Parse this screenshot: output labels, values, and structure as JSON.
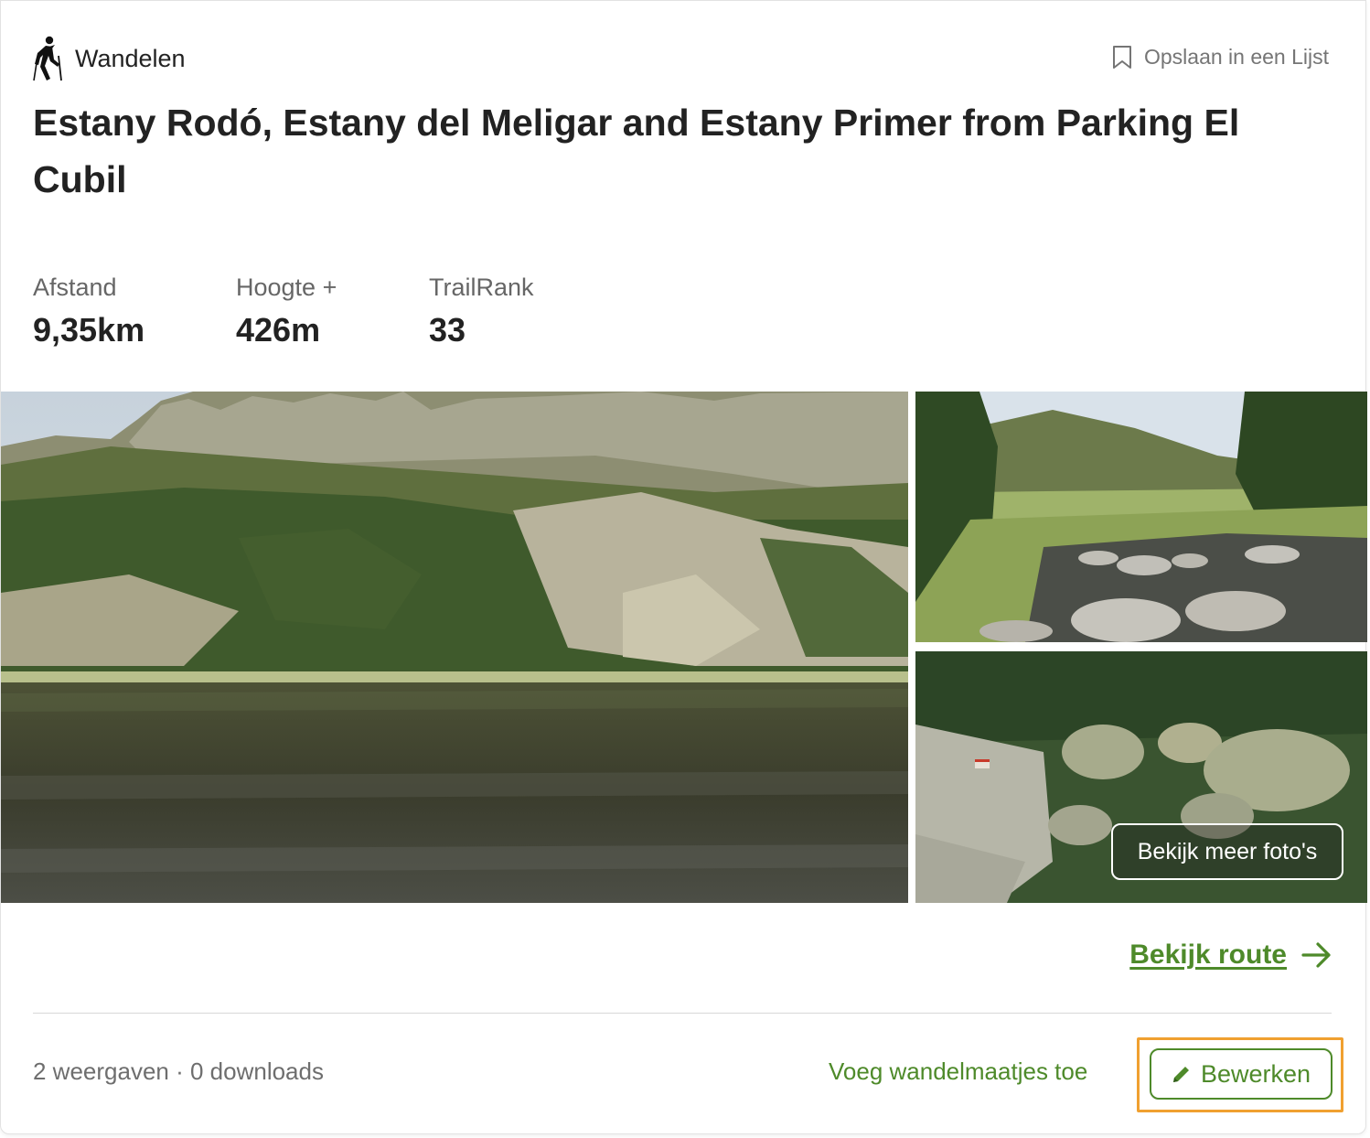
{
  "activity": {
    "icon": "hiker-icon",
    "label": "Wandelen"
  },
  "save_list": {
    "icon": "bookmark-icon",
    "label": "Opslaan in een Lijst"
  },
  "title": "Estany Rodó, Estany del Meligar and Estany Primer from Parking El Cubil",
  "stats": [
    {
      "label": "Afstand",
      "value": "9,35km"
    },
    {
      "label": "Hoogte +",
      "value": "426m"
    },
    {
      "label": "TrailRank",
      "value": "33"
    }
  ],
  "photos": {
    "more_label": "Bekijk meer foto's"
  },
  "route_link": {
    "label": "Bekijk route",
    "icon": "arrow-right-icon"
  },
  "footer": {
    "counts": "2 weergaven · 0 downloads",
    "add_buddies": "Voeg wandelmaatjes toe",
    "edit": {
      "label": "Bewerken",
      "icon": "pencil-icon"
    }
  },
  "colors": {
    "accent": "#4e8a2a",
    "highlight": "#f0a030",
    "text": "#222222",
    "muted": "#757575"
  }
}
